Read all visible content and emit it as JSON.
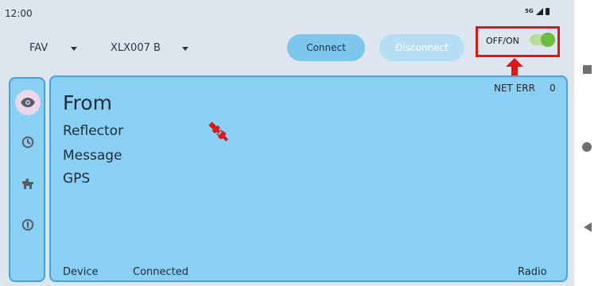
{
  "status_bar": {
    "time": "12:00",
    "network": "5G"
  },
  "toolbar": {
    "favorites_select": "FAV",
    "device_select": "XLX007 B",
    "connect_label": "Connect",
    "disconnect_label": "Disconnect",
    "toggle_label": "OFF/ON",
    "toggle_on": true
  },
  "sidebar": {
    "items": [
      {
        "icon": "eye-icon",
        "selected": true
      },
      {
        "icon": "history-icon",
        "selected": false
      },
      {
        "icon": "dog-icon",
        "selected": false
      },
      {
        "icon": "info-icon",
        "selected": false
      }
    ]
  },
  "main": {
    "net_err_label": "NET ERR",
    "net_err_count": "0",
    "from_label": "From",
    "reflector_label": "Reflector",
    "message_label": "Message",
    "gps_label": "GPS",
    "status_icon": "unplugged-icon",
    "footer": {
      "device_label": "Device",
      "connection_status": "Connected",
      "radio_label": "Radio"
    }
  },
  "colors": {
    "panel_bg": "#8ad0f4",
    "panel_border": "#4a9fde",
    "connect_bg": "#7fc6ed",
    "disconnect_bg": "#b5ddf3",
    "switch_on": "#6cbc42",
    "highlight_red": "#e01515"
  }
}
